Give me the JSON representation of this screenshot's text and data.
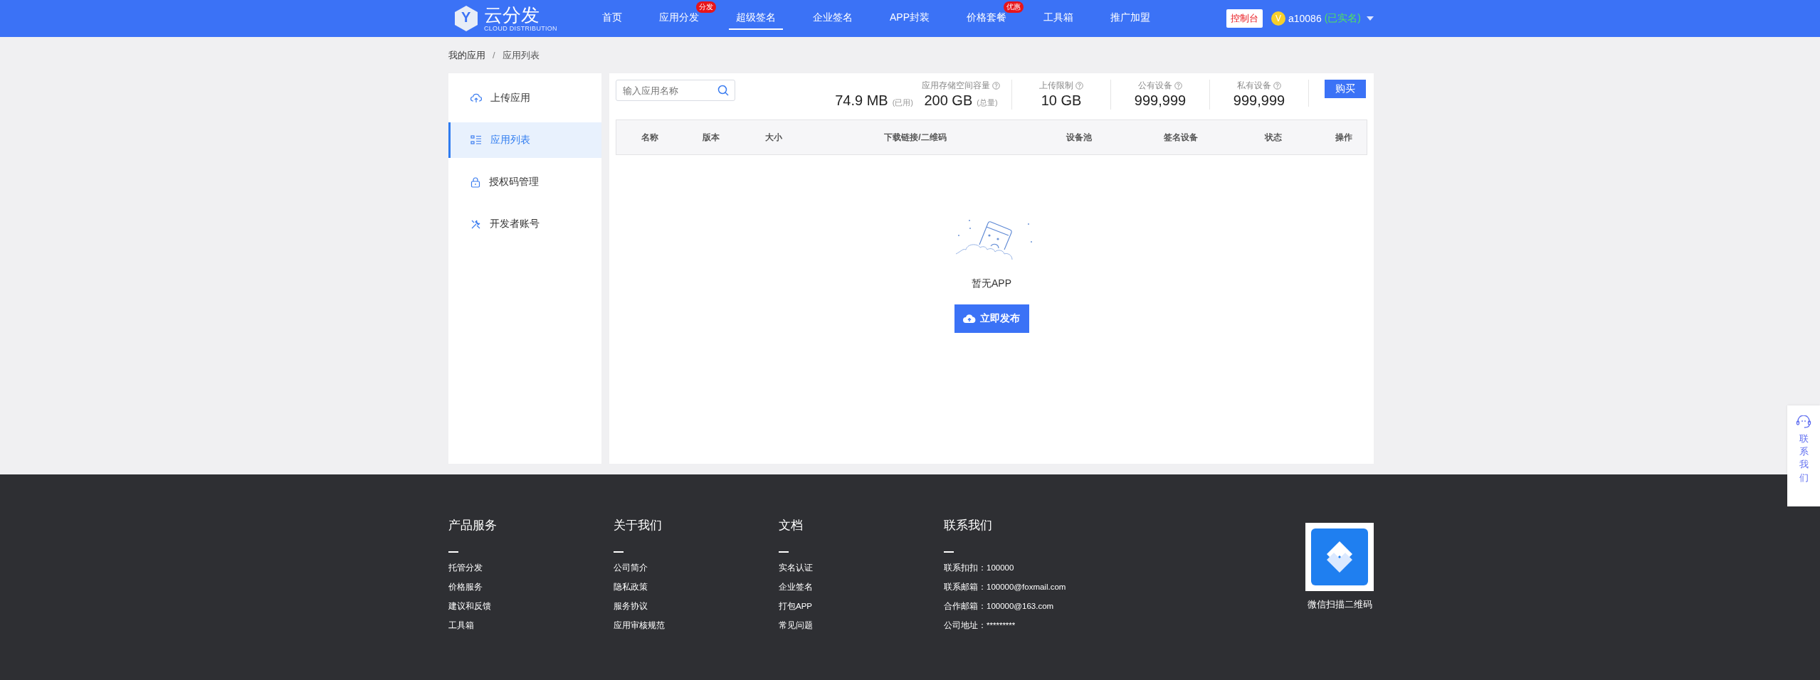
{
  "header": {
    "logo": {
      "mark": "Y",
      "name": "云分发",
      "tagline": "CLOUD DISTRIBUTION"
    },
    "nav": [
      {
        "label": "首页",
        "selected": false
      },
      {
        "label": "应用分发",
        "selected": false,
        "badge": "分发"
      },
      {
        "label": "超级签名",
        "selected": true
      },
      {
        "label": "企业签名",
        "selected": false
      },
      {
        "label": "APP封装",
        "selected": false
      },
      {
        "label": "价格套餐",
        "selected": false,
        "badge": "优惠"
      },
      {
        "label": "工具箱",
        "selected": false
      },
      {
        "label": "推广加盟",
        "selected": false
      }
    ],
    "console_button": "控制台",
    "user": {
      "avatar": "V",
      "name": "a10086",
      "verified": "(已实名)"
    }
  },
  "breadcrumb": {
    "items": [
      "我的应用",
      "应用列表"
    ],
    "separator": "/"
  },
  "sidebar": {
    "items": [
      {
        "label": "上传应用",
        "kind": "upload",
        "selected": false
      },
      {
        "label": "应用列表",
        "kind": "list",
        "selected": true
      },
      {
        "label": "授权码管理",
        "kind": "lock",
        "selected": false
      },
      {
        "label": "开发者账号",
        "kind": "tools",
        "selected": false
      }
    ]
  },
  "toolbar": {
    "search": {
      "placeholder": "输入应用名称"
    },
    "storage": {
      "used": "74.9 MB",
      "used_note": "(已用)",
      "label": "应用存储空间容量",
      "total": "200 GB",
      "total_note": "(总量)"
    },
    "stats": [
      {
        "label": "上传限制",
        "value": "10 GB"
      },
      {
        "label": "公有设备",
        "value": "999,999"
      },
      {
        "label": "私有设备",
        "value": "999,999"
      }
    ],
    "buy_button": "购买"
  },
  "table": {
    "columns": [
      "名称",
      "版本",
      "大小",
      "下载链接/二维码",
      "设备池",
      "签名设备",
      "状态",
      "操作"
    ]
  },
  "empty_state": {
    "message": "暂无APP",
    "button": "立即发布"
  },
  "footer": {
    "columns": [
      {
        "title": "产品服务",
        "links": [
          "托管分发",
          "价格服务",
          "建议和反馈",
          "工具箱"
        ]
      },
      {
        "title": "关于我们",
        "links": [
          "公司简介",
          "隐私政策",
          "服务协议",
          "应用审核规范"
        ]
      },
      {
        "title": "文档",
        "links": [
          "实名认证",
          "企业签名",
          "打包APP",
          "常见问题"
        ]
      }
    ],
    "contact": {
      "title": "联系我们",
      "lines": [
        {
          "label": "联系扣扣：",
          "value": "100000"
        },
        {
          "label": "联系邮箱：",
          "value": "100000@foxmail.com"
        },
        {
          "label": "合作邮箱：",
          "value": "100000@163.com"
        },
        {
          "label": "公司地址：",
          "value": "*********"
        }
      ]
    },
    "qr_caption": "微信扫描二维码"
  },
  "side_contact": {
    "label": "联系我们"
  }
}
